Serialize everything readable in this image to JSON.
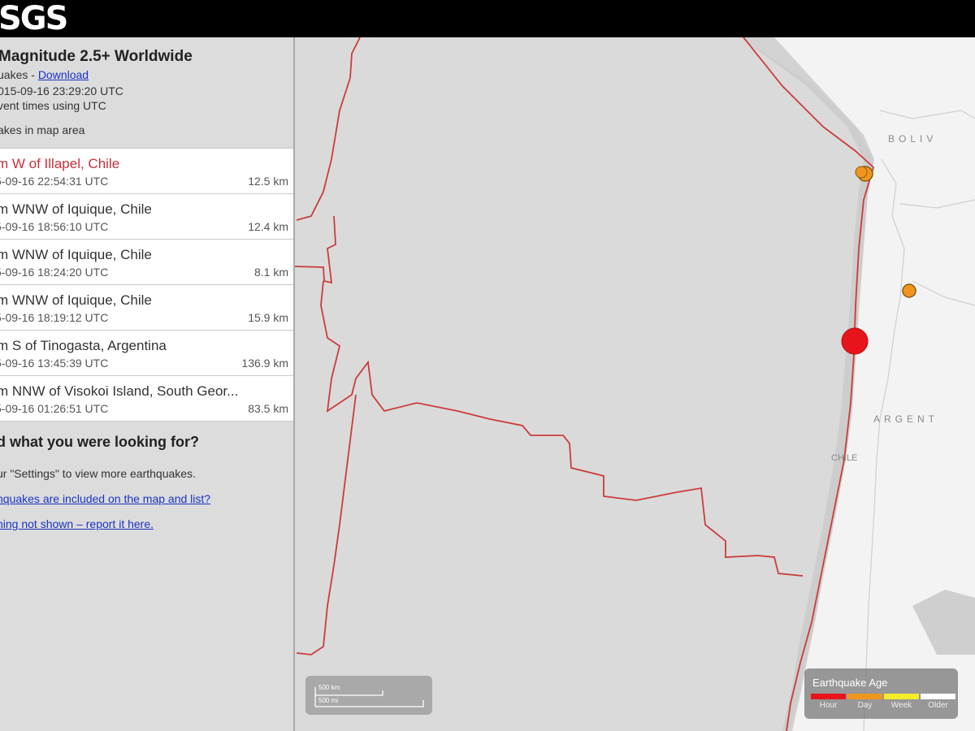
{
  "header": {
    "logo_text": "SGS"
  },
  "feed": {
    "title": "Magnitude 2.5+ Worldwide",
    "quakes_prefix": "uakes - ",
    "download_link": "Download",
    "updated": "015-09-16 23:29:20 UTC",
    "times_note": "vent times using UTC",
    "map_area_note": "akes in map area"
  },
  "earthquakes": [
    {
      "title": "m W of Illapel, Chile",
      "time": "5-09-16 22:54:31 UTC",
      "depth": "12.5 km"
    },
    {
      "title": "m WNW of Iquique, Chile",
      "time": "5-09-16 18:56:10 UTC",
      "depth": "12.4 km"
    },
    {
      "title": "m WNW of Iquique, Chile",
      "time": "5-09-16 18:24:20 UTC",
      "depth": "8.1 km"
    },
    {
      "title": "m WNW of Iquique, Chile",
      "time": "5-09-16 18:19:12 UTC",
      "depth": "15.9 km"
    },
    {
      "title": "m S of Tinogasta, Argentina",
      "time": "5-09-16 13:45:39 UTC",
      "depth": "136.9 km"
    },
    {
      "title": "m NNW of Visokoi Island, South Geor...",
      "time": "5-09-16 01:26:51 UTC",
      "depth": "83.5 km"
    }
  ],
  "not_found": {
    "heading": "d what you were looking for?",
    "settings_text": "ur \"Settings\" to view more earthquakes.",
    "included_link": "hquakes are included on the map and list?",
    "report_link": "hing not shown – report it here."
  },
  "map": {
    "labels": {
      "bolivia": "BOLIV",
      "argentina": "ARGENT",
      "chile": "CHILE"
    },
    "scale": {
      "km": "500 km",
      "mi": "500 mi"
    },
    "legend": {
      "title": "Earthquake Age",
      "items": [
        {
          "label": "Hour",
          "color": "#e8141c"
        },
        {
          "label": "Day",
          "color": "#f0961e"
        },
        {
          "label": "Week",
          "color": "#f4ec28"
        },
        {
          "label": "Older",
          "color": "#ffffff"
        }
      ]
    },
    "colors": {
      "hour": "#e8141c",
      "day": "#f0961e",
      "plate_boundary": "#cc3b3b"
    }
  }
}
